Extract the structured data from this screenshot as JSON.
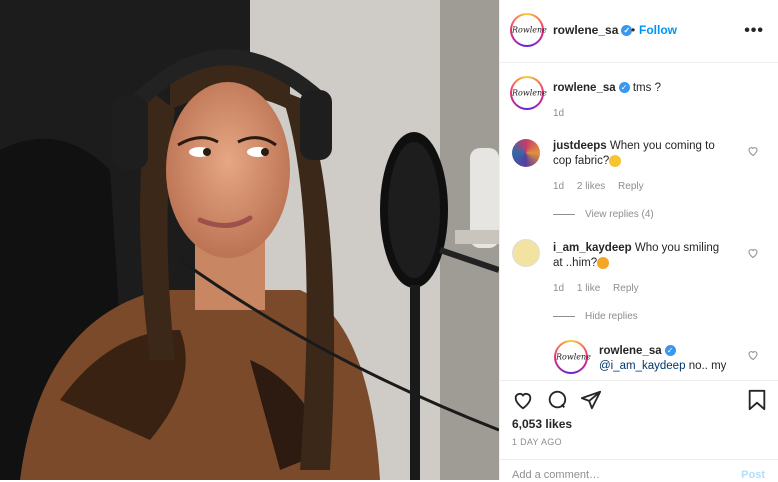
{
  "post": {
    "username": "rowlene_sa",
    "avatar_text": "Rowlene",
    "follow_label": "Follow",
    "dot": "•",
    "more_label": "•••"
  },
  "caption": {
    "username": "rowlene_sa",
    "text": "tms ?",
    "time": "1d"
  },
  "comments": [
    {
      "username": "justdeeps",
      "text": "When you coming to cop fabric?",
      "time": "1d",
      "likes": "2 likes",
      "reply_label": "Reply",
      "view_replies": "View replies (4)"
    },
    {
      "username": "i_am_kaydeep",
      "text": "Who you smiling at ..him?",
      "time": "1d",
      "likes": "1 like",
      "reply_label": "Reply",
      "hide_replies": "Hide replies"
    }
  ],
  "reply": {
    "username": "rowlene_sa",
    "mention": "@i_am_kaydeep",
    "text": "no.. my"
  },
  "stats": {
    "likes": "6,053 likes",
    "time_ago": "1 DAY AGO"
  },
  "add_comment": {
    "placeholder": "Add a comment…",
    "post_label": "Post"
  },
  "colors": {
    "verified": "#3897f0",
    "follow": "#0095f6",
    "shirt": "#7a4a2a"
  }
}
